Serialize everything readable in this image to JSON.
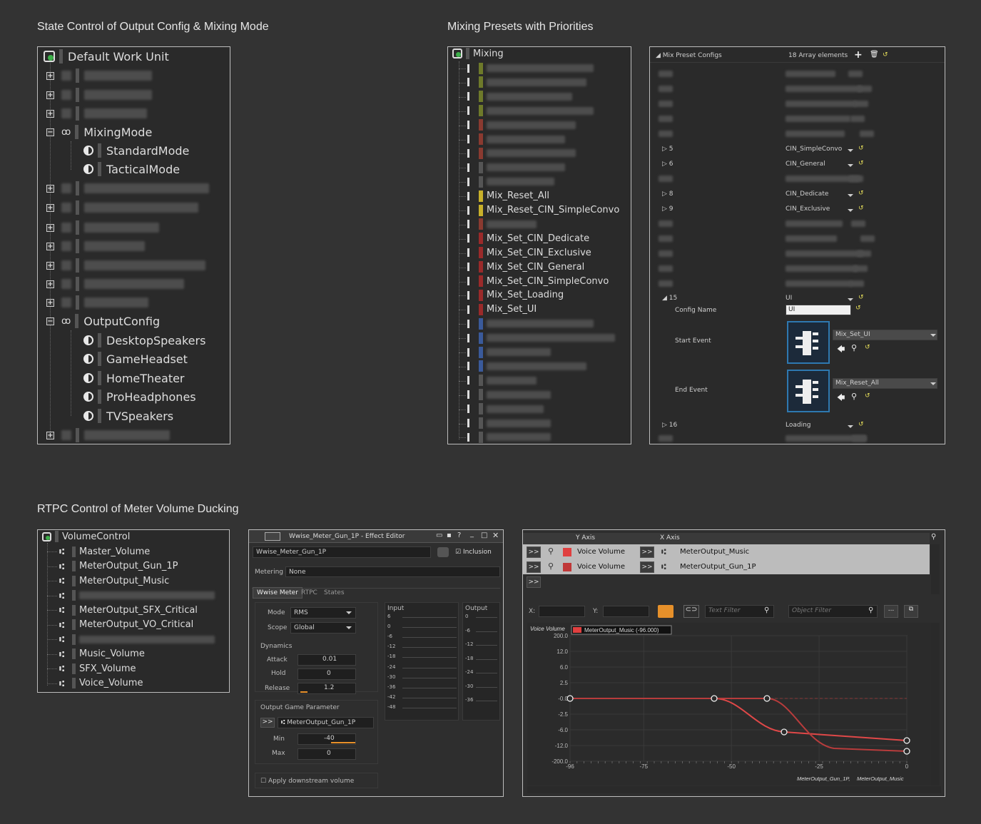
{
  "headings": {
    "state_control": "State Control of Output Config & Mixing Mode",
    "mixing_presets": "Mixing Presets with Priorities",
    "rtpc_control": "RTPC Control of Meter Volume Ducking"
  },
  "states_tree": {
    "root": "Default Work Unit",
    "mixing_mode": "MixingMode",
    "mixing_children": [
      "StandardMode",
      "TacticalMode"
    ],
    "output_config": "OutputConfig",
    "output_children": [
      "DesktopSpeakers",
      "GameHeadset",
      "HomeTheater",
      "ProHeadphones",
      "TVSpeakers"
    ]
  },
  "mixing_tree": {
    "root": "Mixing",
    "items": [
      "Mix_Reset_All",
      "Mix_Reset_CIN_SimpleConvo",
      "Mix_Set_CIN_Dedicate",
      "Mix_Set_CIN_Exclusive",
      "Mix_Set_CIN_General",
      "Mix_Set_CIN_SimpleConvo",
      "Mix_Set_Loading",
      "Mix_Set_UI"
    ]
  },
  "mix_preset": {
    "header_label": "Mix Preset Configs",
    "header_count": "18 Array elements",
    "rows": [
      {
        "idx": "5",
        "value": "CIN_SimpleConvo"
      },
      {
        "idx": "6",
        "value": "CIN_General"
      },
      {
        "idx": "8",
        "value": "CIN_Dedicate"
      },
      {
        "idx": "9",
        "value": "CIN_Exclusive"
      },
      {
        "idx": "15",
        "value": "UI"
      },
      {
        "idx": "16",
        "value": "Loading"
      }
    ],
    "config_name_label": "Config Name",
    "config_name_value": "UI",
    "start_event_label": "Start Event",
    "start_event_value": "Mix_Set_UI",
    "end_event_label": "End Event",
    "end_event_value": "Mix_Reset_All"
  },
  "rtpc_tree": {
    "root": "VolumeControl",
    "items": [
      "Master_Volume",
      "MeterOutput_Gun_1P",
      "MeterOutput_Music",
      "MeterOutput_SFX_Critical",
      "MeterOutput_VO_Critical",
      "Music_Volume",
      "SFX_Volume",
      "Voice_Volume"
    ]
  },
  "effect_editor": {
    "title": "Wwise_Meter_Gun_1P - Effect Editor",
    "name": "Wwise_Meter_Gun_1P",
    "inclusion": "Inclusion",
    "metering_label": "Metering",
    "metering_value": "None",
    "tabs": [
      "Wwise Meter",
      "RTPC",
      "States"
    ],
    "mode_label": "Mode",
    "mode_value": "RMS",
    "scope_label": "Scope",
    "scope_value": "Global",
    "dynamics_label": "Dynamics",
    "attack_label": "Attack",
    "attack_value": "0.01",
    "hold_label": "Hold",
    "hold_value": "0",
    "release_label": "Release",
    "release_value": "1.2",
    "ogp_label": "Output Game Parameter",
    "ogp_value": "MeterOutput_Gun_1P",
    "min_label": "Min",
    "min_value": "-40",
    "max_label": "Max",
    "max_value": "0",
    "apply_label": "Apply downstream volume",
    "input_label": "Input",
    "output_label": "Output",
    "input_ticks": [
      "6",
      "0",
      "-6",
      "-12",
      "-18",
      "-24",
      "-30",
      "-36",
      "-42",
      "-48"
    ],
    "output_ticks": [
      "0",
      "-6",
      "-12",
      "-18",
      "-24",
      "-30",
      "-36"
    ]
  },
  "rtpc_graph": {
    "y_axis_header": "Y Axis",
    "x_axis_header": "X Axis",
    "rows": [
      {
        "y": "Voice Volume",
        "x": "MeterOutput_Music"
      },
      {
        "y": "Voice Volume",
        "x": "MeterOutput_Gun_1P"
      }
    ],
    "x_label": "X:",
    "y_label": "Y:",
    "text_filter": "Text Filter",
    "object_filter": "Object Filter",
    "graph_y_title": "Voice Volume",
    "graph_tooltip": "MeterOutput_Music (-96.000)",
    "y_ticks": [
      "200.0",
      "12.0",
      "6.0",
      "2.5",
      "-0.0",
      "-2.5",
      "-6.0",
      "-12.0",
      "-200.0"
    ],
    "x_ticks": [
      "-96",
      "-75",
      "-50",
      "-25",
      "0"
    ],
    "x_title_1": "MeterOutput_Gun_1P,",
    "x_title_2": "MeterOutput_Music",
    "colors": {
      "curve": "#e04848",
      "curve_dark": "#b83c3c",
      "swatch": "#e04040"
    }
  }
}
